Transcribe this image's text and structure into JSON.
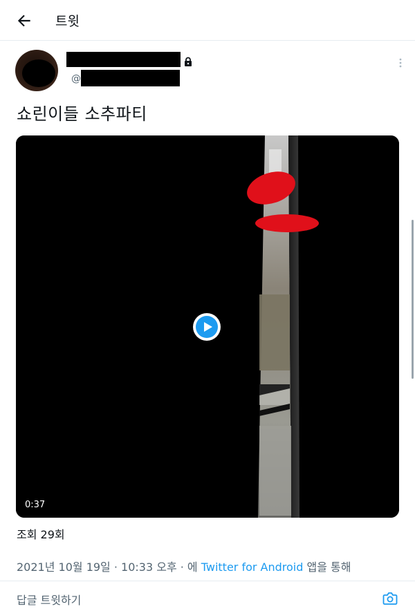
{
  "header": {
    "title": "트윗",
    "back_icon": "back-arrow-icon"
  },
  "tweet": {
    "handle_prefix": "@",
    "text": "쇼린이들 소추파티",
    "video": {
      "duration": "0:37",
      "play_icon": "play-icon"
    },
    "views": "조회 29회",
    "timestamp": "2021년 10월 19일 · 10:33 오후 · 에 ",
    "client": "Twitter for Android",
    "client_suffix": " 앱을 통해"
  },
  "reply": {
    "label": "답글 트윗하기",
    "camera_icon": "camera-icon"
  },
  "colors": {
    "accent": "#1d9bf0",
    "muted_text": "#536471",
    "divider": "#e6ecf0",
    "redaction": "#e0101a"
  }
}
